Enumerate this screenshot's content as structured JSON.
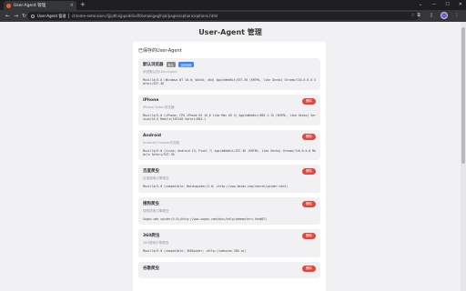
{
  "browser": {
    "tab_title": "User-Agent 管理",
    "new_tab": "+",
    "close_tab": "×",
    "window_minimize": "—",
    "window_maximize": "☐",
    "window_close": "✕",
    "collapse": "⌄",
    "url_chip": "User-Agent 管理",
    "url": "chrome-extension://jjijdfcejppoddicdfcbmakigoglhjal/pages/options/options.html",
    "back": "←",
    "forward": "→",
    "reload": "↻"
  },
  "page": {
    "title": "User-Agent 管理",
    "section_heading": "已保存的User-Agent"
  },
  "cards": [
    {
      "name": "默认浏览器",
      "badges": [
        "默认",
        "当前使用"
      ],
      "desc": "系统默认的User-Agent",
      "ua": "Mozilla/5.0 (Windows NT 10.0; Win64; x64) AppleWebKit/537.36 (KHTML, like Gecko) Chrome/134.0.0.0 Safari/537.36",
      "delete": ""
    },
    {
      "name": "iPhone",
      "desc": "iPhone Safari浏览器",
      "ua": "Mozilla/5.0 (iPhone; CPU iPhone OS 16_6 like Mac OS X) AppleWebKit/605.1.15 (KHTML, like Gecko) Version/16.6 Mobile/15E148 Safari/604.1",
      "delete": "删除"
    },
    {
      "name": "Android",
      "desc": "Android Chrome浏览器",
      "ua": "Mozilla/5.0 (Linux; Android 13; Pixel 7) AppleWebKit/537.36 (KHTML, like Gecko) Chrome/116.0.0.0 Mobile Safari/537.36",
      "delete": "删除"
    },
    {
      "name": "百度爬虫",
      "desc": "百度搜索引擎爬虫",
      "ua": "Mozilla/5.0 (compatible; Baiduspider/2.0; +http://www.baidu.com/search/spider.html)",
      "delete": "删除"
    },
    {
      "name": "搜狗爬虫",
      "desc": "搜狗搜索引擎爬虫",
      "ua": "Sogou web spider/4.0(+http://www.sogou.com/docs/help/webmasters.htm#07)",
      "delete": "删除"
    },
    {
      "name": "360爬虫",
      "desc": "360搜索引擎爬虫",
      "ua": "Mozilla/5.0 (compatible; 360Spider; +http://webscan.360.cn)",
      "delete": "删除"
    },
    {
      "name": "谷歌爬虫",
      "desc": "",
      "ua": "",
      "delete": "删除"
    }
  ]
}
